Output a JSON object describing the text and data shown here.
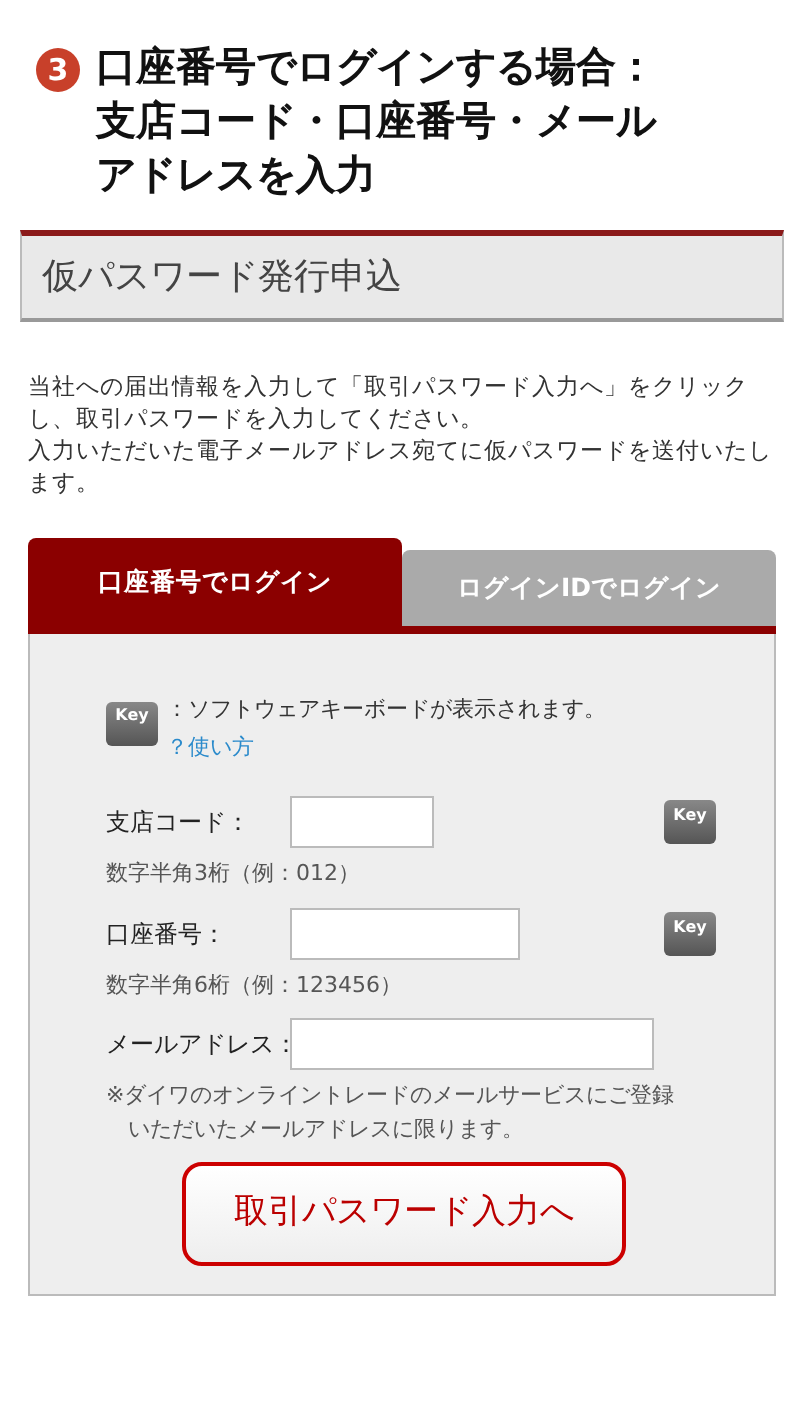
{
  "heading": {
    "number": "3",
    "lines": [
      "口座番号でログインする場合：",
      "支店コード・口座番号・メール",
      "アドレスを入力"
    ]
  },
  "section_title": "仮パスワード発行申込",
  "description": [
    "当社への届出情報を入力して「取引パスワード入力へ」をクリックし、取引パスワードを入力してください。",
    "入力いただいた電子メールアドレス宛てに仮パスワードを送付いたします。"
  ],
  "tabs": [
    {
      "label": "口座番号でログイン",
      "selected": true
    },
    {
      "label": "ログインIDでログイン",
      "selected": false
    }
  ],
  "keyboard_note": {
    "key_label": "Key",
    "text": "：ソフトウェアキーボードが表示されます。",
    "help_link": "？使い方"
  },
  "fields": [
    {
      "kind": "short",
      "label": "支店コード：",
      "hint": "数字半角3桁（例：012）",
      "key_label": "Key"
    },
    {
      "kind": "medium",
      "label": "口座番号：",
      "hint": "数字半角6桁（例：123456）",
      "key_label": "Key"
    },
    {
      "kind": "long",
      "label": "メールアドレス：",
      "hint": "※ダイワのオンライントレードのメールサービスにご登録いただいたメールアドレスに限ります。"
    }
  ],
  "submit_button": "取引パスワード入力へ"
}
